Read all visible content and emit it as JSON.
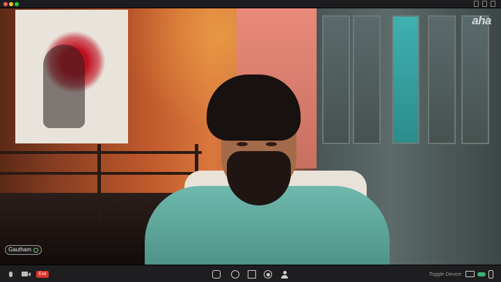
{
  "window": {
    "watermark": "aha"
  },
  "participant": {
    "name": "Gautham"
  },
  "controls": {
    "end_label": "End",
    "toggle_device_label": "Toggle Device"
  },
  "colors": {
    "end_button": "#d9342b",
    "toggle_on": "#3cb371"
  },
  "icons": [
    "mic-icon",
    "camera-icon",
    "chat-icon",
    "participants-icon",
    "share-screen-icon",
    "record-icon",
    "user-icon",
    "laptop-icon",
    "phone-icon"
  ]
}
